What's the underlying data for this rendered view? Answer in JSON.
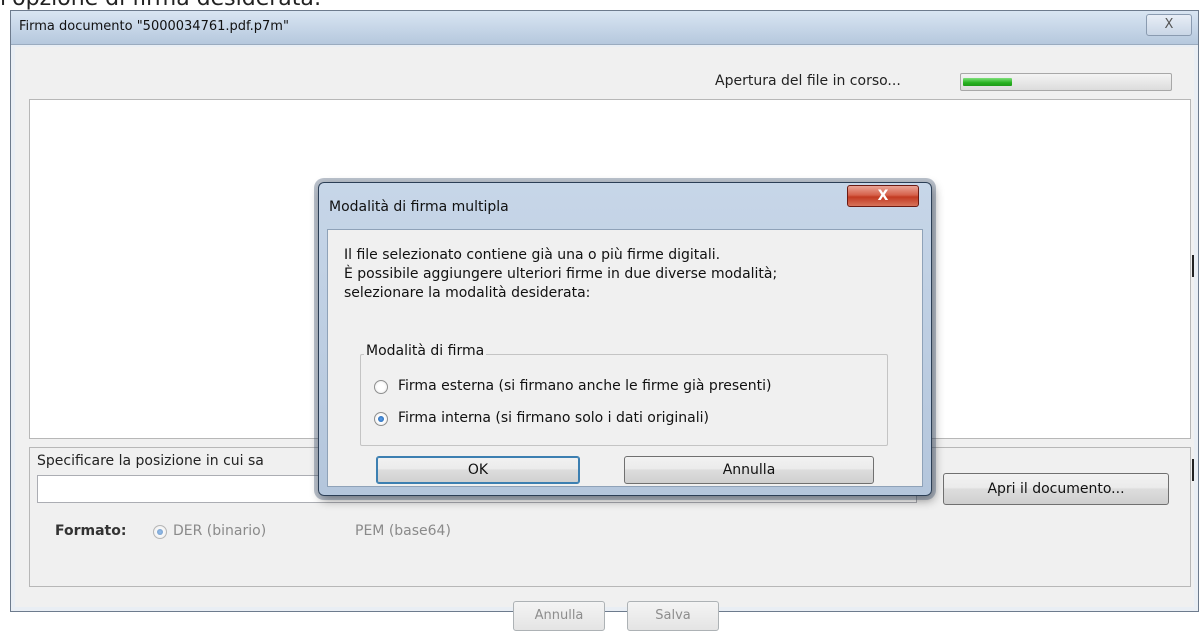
{
  "page_caption": "l'opzione di firma desiderata:",
  "main_window": {
    "title": "Firma documento \"5000034761.pdf.p7m\"",
    "close_glyph": "X",
    "status_text": "Apertura del file in corso...",
    "progress_fraction": 0.24,
    "position_label": "Specificare la posizione in cui sa",
    "open_document_label": "Apri il documento...",
    "format_label": "Formato:",
    "format_options": [
      "DER (binario)",
      "PEM (base64)"
    ],
    "cancel_label": "Annulla",
    "save_label": "Salva"
  },
  "modal": {
    "title": "Modalità di firma multipla",
    "close_glyph": "X",
    "message_lines": [
      "Il file selezionato contiene già una o più firme digitali.",
      "È possibile aggiungere ulteriori firme in due diverse modalità;",
      "selezionare la modalità desiderata:"
    ],
    "group_title": "Modalità di firma",
    "options": [
      {
        "label": "Firma esterna (si firmano anche le firme già presenti)",
        "checked": false
      },
      {
        "label": "Firma interna (si firmano solo i dati originali)",
        "checked": true
      }
    ],
    "ok_label": "OK",
    "cancel_label": "Annulla"
  }
}
